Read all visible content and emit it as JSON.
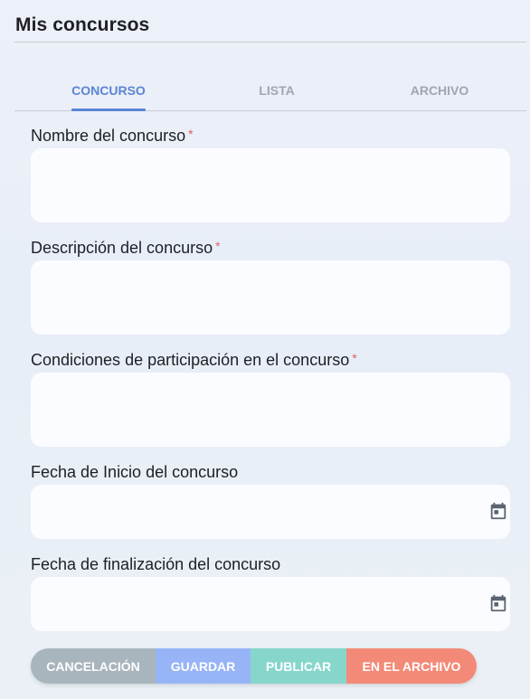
{
  "header": {
    "title": "Mis concursos"
  },
  "tabs": [
    {
      "label": "CONCURSO",
      "active": true
    },
    {
      "label": "LISTA",
      "active": false
    },
    {
      "label": "ARCHIVO",
      "active": false
    }
  ],
  "form": {
    "name": {
      "label": "Nombre del concurso",
      "required_mark": "*",
      "value": ""
    },
    "description": {
      "label": "Descripción del concurso",
      "required_mark": "*",
      "value": ""
    },
    "conditions": {
      "label": "Condiciones de participación en el concurso",
      "required_mark": "*",
      "value": ""
    },
    "start_date": {
      "label": "Fecha de Inicio del concurso",
      "value": "",
      "icon": "calendar-icon"
    },
    "end_date": {
      "label": "Fecha de finalización del concurso",
      "value": "",
      "icon": "calendar-icon"
    }
  },
  "actions": {
    "cancel": "CANCELACIÓN",
    "save": "GUARDAR",
    "publish": "PUBLICAR",
    "archive": "EN EL ARCHIVO"
  },
  "colors": {
    "accent": "#5a84d4",
    "cancel": "#a8b5bd",
    "save": "#97b4f7",
    "publish": "#87d6cc",
    "archive": "#f38a78",
    "required": "#e06060"
  }
}
